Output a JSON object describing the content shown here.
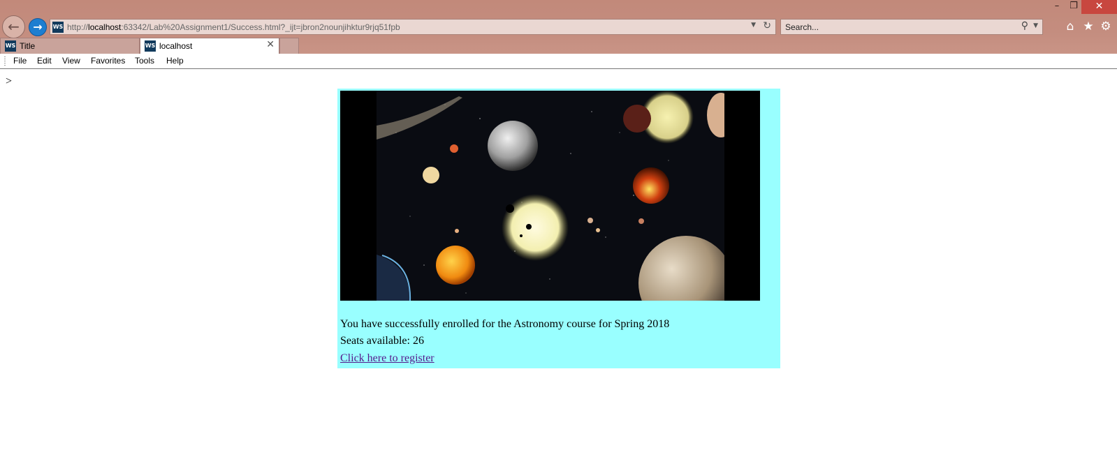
{
  "browser": {
    "window_controls": {
      "minimize": "–",
      "restore": "❐",
      "close": "✕"
    },
    "address": {
      "url_prefix": "http://",
      "url_host": "localhost",
      "url_rest": ":63342/Lab%20Assignment1/Success.html?_ijt=jbron2nounjihktur9rjq51fpb",
      "site_icon": "WS"
    },
    "search": {
      "placeholder": "Search..."
    },
    "tabs": [
      {
        "label": "Title",
        "icon": "WS",
        "active": false
      },
      {
        "label": "localhost",
        "icon": "WS",
        "active": true
      }
    ],
    "menu": [
      "File",
      "Edit",
      "View",
      "Favorites",
      "Tools",
      "Help"
    ]
  },
  "page": {
    "stray_text": ">",
    "image_description_icon": "space-planets-image",
    "enroll_message": "You have successfully enrolled for the Astronomy course for Spring 2018",
    "seats_label": "Seats available:",
    "seats_value": "26",
    "register_link": "Click here to register",
    "colors": {
      "content_background": "#99ffff",
      "link_visited": "#551a8b",
      "chrome": "#c48d7f"
    }
  }
}
